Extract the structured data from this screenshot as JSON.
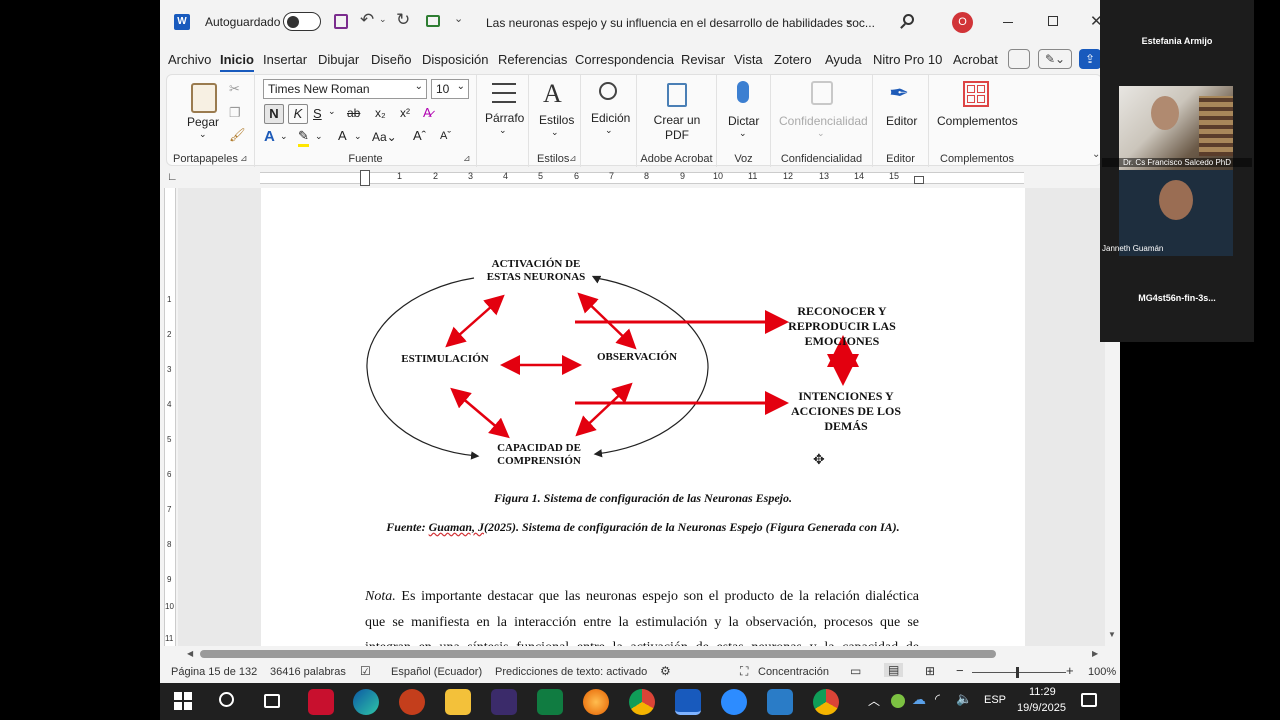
{
  "titlebar": {
    "autosave_label": "Autoguardado",
    "doc_title": "Las neuronas espejo y su influencia en el desarrollo de habilidades soc...",
    "user_initial": "O"
  },
  "menu": [
    "Archivo",
    "Inicio",
    "Insertar",
    "Dibujar",
    "Diseño",
    "Disposición",
    "Referencias",
    "Correspondencia",
    "Revisar",
    "Vista",
    "Zotero",
    "Ayuda",
    "Nitro Pro 10",
    "Acrobat"
  ],
  "ribbon": {
    "paste_label": "Pegar",
    "clipboard_group": "Portapapeles",
    "font_name": "Times New Roman",
    "font_size": "10",
    "bold": "N",
    "italic": "K",
    "underline": "S",
    "strike": "ab",
    "subscript": "x₂",
    "superscript": "x²",
    "font_group": "Fuente",
    "paragraph_label": "Párrafo",
    "styles_label": "Estilos",
    "styles_group": "Estilos",
    "editing_label": "Edición",
    "create_pdf_label": "Crear un PDF",
    "acrobat_group": "Adobe Acrobat",
    "dictate_label": "Dictar",
    "voice_group": "Voz",
    "confidentiality_label": "Confidencialidad",
    "confidentiality_group": "Confidencialidad",
    "editor_label": "Editor",
    "editor_group": "Editor",
    "addins_label": "Complementos",
    "addins_group": "Complementos"
  },
  "ruler_numbers": [
    "1",
    "2",
    "3",
    "4",
    "5",
    "6",
    "7",
    "8",
    "9",
    "10",
    "11",
    "12",
    "13",
    "14",
    "15"
  ],
  "vruler_numbers": [
    "1",
    "2",
    "3",
    "4",
    "5",
    "6",
    "7",
    "8",
    "9",
    "10",
    "11"
  ],
  "diagram": {
    "top": "ACTIVACIÓN DE ESTAS NEURONAS",
    "left": "ESTIMULACIÓN",
    "right": "OBSERVACIÓN",
    "bottom": "CAPACIDAD DE COMPRENSIÓN",
    "out1": "RECONOCER Y REPRODUCIR LAS EMOCIONES",
    "out2": "INTENCIONES Y ACCIONES DE LOS DEMÁS",
    "arrow_color": "#e3000f"
  },
  "caption": "Figura 1. Sistema de configuración de las Neuronas Espejo.",
  "source_prefix": "Fuente: ",
  "source_author": "Guaman, J",
  "source_rest": "(2025). Sistema de configuración de la Neuronas Espejo (Figura Generada con IA).",
  "body": {
    "nota": "Nota.",
    "line1": " Es importante destacar que las neuronas espejo son el producto de la relación dialéctica",
    "line2": "que se manifiesta en la interacción entre la estimulación y la observación, procesos que se",
    "line3": "integran en una síntesis funcional entre la activación de estas neuronas y la capacidad de"
  },
  "status": {
    "page": "Página 15 de 132",
    "words": "36416 palabras",
    "language": "Español (Ecuador)",
    "predictions": "Predicciones de texto: activado",
    "focus": "Concentración",
    "zoom": "100%"
  },
  "video": {
    "host": "Estefania Armijo",
    "p1": "Dr. Cs Francisco Salcedo PhD",
    "p2": "Janneth Guamán",
    "p3": "MG4st56n-fin-3s..."
  },
  "tray": {
    "lang": "ESP",
    "time": "11:29",
    "date": "19/9/2025"
  }
}
